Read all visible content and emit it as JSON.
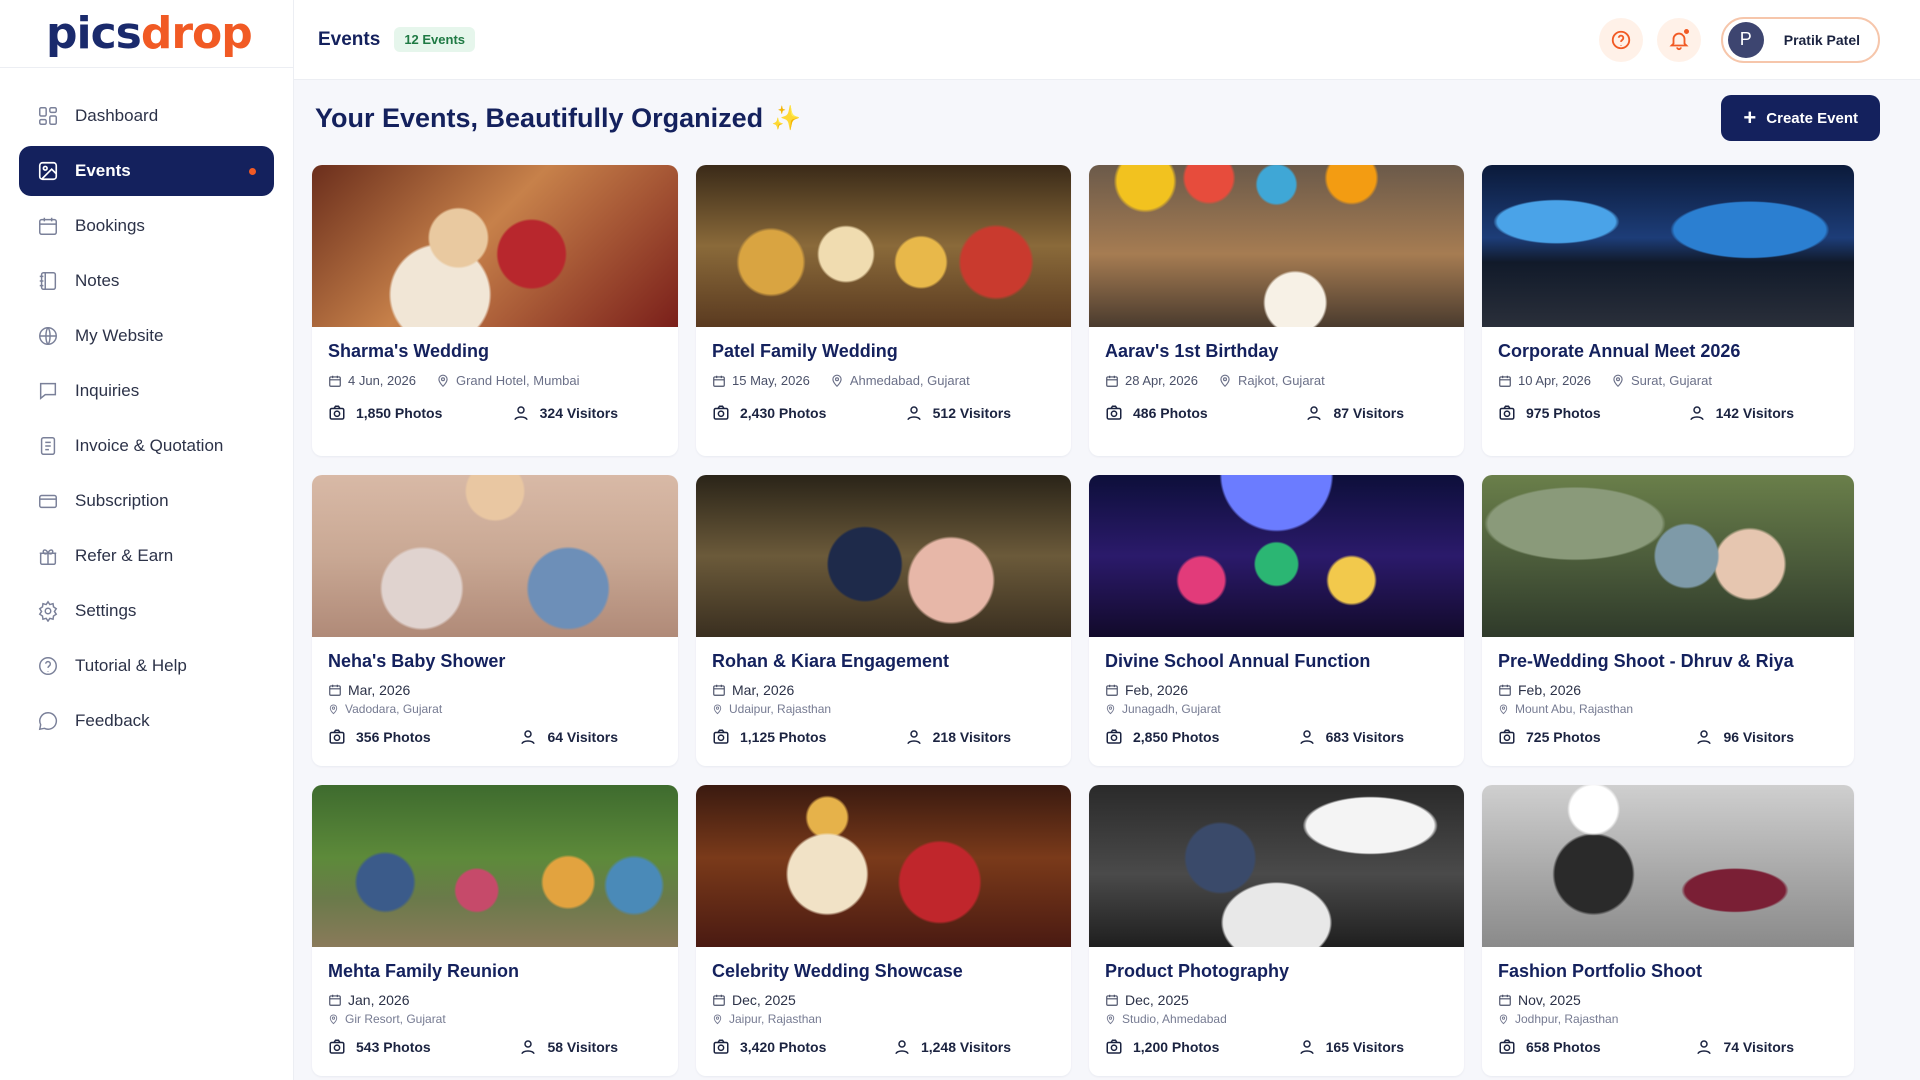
{
  "brand": {
    "part1": "pics",
    "part2": "drop"
  },
  "sidebar": {
    "items": [
      {
        "label": "Dashboard",
        "icon": "grid-icon"
      },
      {
        "label": "Events",
        "icon": "image-icon"
      },
      {
        "label": "Bookings",
        "icon": "calendar-icon"
      },
      {
        "label": "Notes",
        "icon": "notebook-icon"
      },
      {
        "label": "My Website",
        "icon": "globe-icon"
      },
      {
        "label": "Inquiries",
        "icon": "chat-icon"
      },
      {
        "label": "Invoice & Quotation",
        "icon": "document-icon"
      },
      {
        "label": "Subscription",
        "icon": "credit-card-icon"
      },
      {
        "label": "Refer & Earn",
        "icon": "gift-icon"
      },
      {
        "label": "Settings",
        "icon": "gear-icon"
      },
      {
        "label": "Tutorial & Help",
        "icon": "help-circle-icon"
      },
      {
        "label": "Feedback",
        "icon": "feedback-icon"
      }
    ]
  },
  "header": {
    "title": "Events",
    "count_badge": "12 Events",
    "user": {
      "initial": "P",
      "name": "Pratik Patel"
    }
  },
  "main": {
    "heading": "Your Events, Beautifully Organized",
    "sparkle": "✨",
    "create_button": "Create Event"
  },
  "events": [
    {
      "title": "Sharma's Wedding",
      "date": "4 Jun, 2026",
      "location": "Grand Hotel, Mumbai",
      "photos": "1,850 Photos",
      "visitors": "324 Visitors"
    },
    {
      "title": "Patel Family Wedding",
      "date": "15 May, 2026",
      "location": "Ahmedabad, Gujarat",
      "photos": "2,430 Photos",
      "visitors": "512 Visitors"
    },
    {
      "title": "Aarav's 1st Birthday",
      "date": "28 Apr, 2026",
      "location": "Rajkot, Gujarat",
      "photos": "486 Photos",
      "visitors": "87 Visitors"
    },
    {
      "title": "Corporate Annual Meet 2026",
      "date": "10 Apr, 2026",
      "location": "Surat, Gujarat",
      "photos": "975 Photos",
      "visitors": "142 Visitors"
    },
    {
      "title": "Neha's Baby Shower",
      "date": "Mar, 2026",
      "location": "Vadodara, Gujarat",
      "photos": "356 Photos",
      "visitors": "64 Visitors"
    },
    {
      "title": "Rohan & Kiara Engagement",
      "date": "Mar, 2026",
      "location": "Udaipur, Rajasthan",
      "photos": "1,125 Photos",
      "visitors": "218 Visitors"
    },
    {
      "title": "Divine School Annual Function",
      "date": "Feb, 2026",
      "location": "Junagadh, Gujarat",
      "photos": "2,850 Photos",
      "visitors": "683 Visitors"
    },
    {
      "title": "Pre-Wedding Shoot - Dhruv & Riya",
      "date": "Feb, 2026",
      "location": "Mount Abu, Rajasthan",
      "photos": "725 Photos",
      "visitors": "96 Visitors"
    },
    {
      "title": "Mehta Family Reunion",
      "date": "Jan, 2026",
      "location": "Gir Resort, Gujarat",
      "photos": "543 Photos",
      "visitors": "58 Visitors"
    },
    {
      "title": "Celebrity Wedding Showcase",
      "date": "Dec, 2025",
      "location": "Jaipur, Rajasthan",
      "photos": "3,420 Photos",
      "visitors": "1,248 Visitors"
    },
    {
      "title": "Product Photography",
      "date": "Dec, 2025",
      "location": "Studio, Ahmedabad",
      "photos": "1,200 Photos",
      "visitors": "165 Visitors"
    },
    {
      "title": "Fashion Portfolio Shoot",
      "date": "Nov, 2025",
      "location": "Jodhpur, Rajasthan",
      "photos": "658 Photos",
      "visitors": "74 Visitors"
    }
  ],
  "colors": {
    "brand_navy": "#14215d",
    "brand_orange": "#f15a24",
    "badge_green": "#1f7a44"
  }
}
